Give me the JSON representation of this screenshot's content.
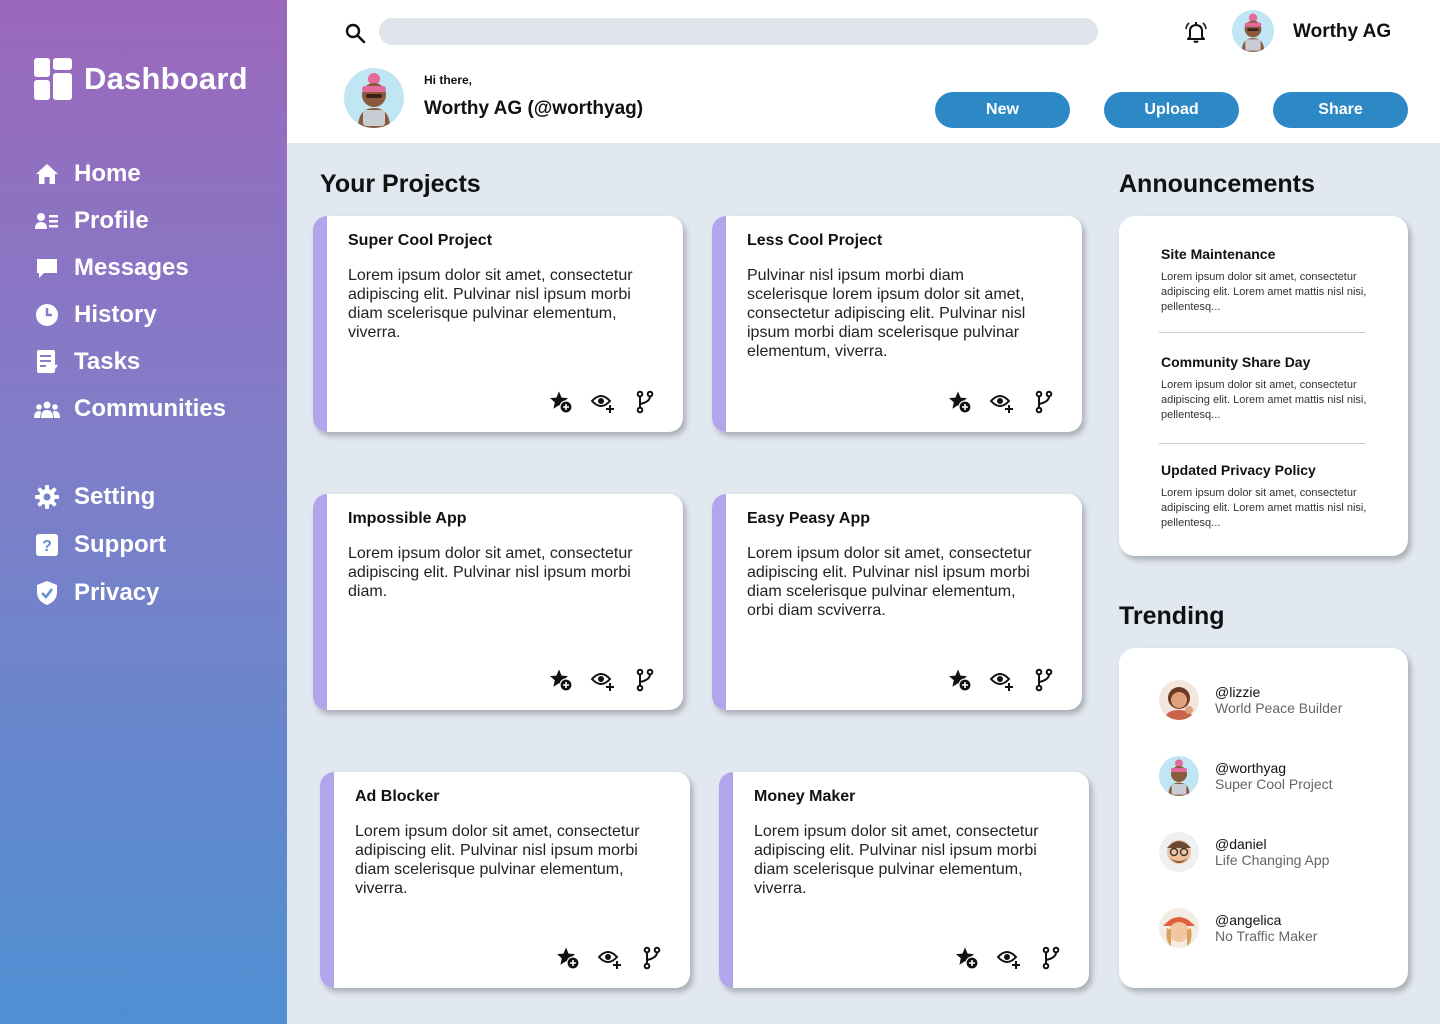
{
  "brand": {
    "title": "Dashboard"
  },
  "nav": {
    "main": [
      {
        "label": "Home",
        "icon": "home-icon"
      },
      {
        "label": "Profile",
        "icon": "profile-icon"
      },
      {
        "label": "Messages",
        "icon": "messages-icon"
      },
      {
        "label": "History",
        "icon": "history-icon"
      },
      {
        "label": "Tasks",
        "icon": "tasks-icon"
      },
      {
        "label": "Communities",
        "icon": "communities-icon"
      }
    ],
    "secondary": [
      {
        "label": "Setting",
        "icon": "gear-icon"
      },
      {
        "label": "Support",
        "icon": "support-icon"
      },
      {
        "label": "Privacy",
        "icon": "shield-icon"
      }
    ]
  },
  "header": {
    "search_value": "",
    "user_name": "Worthy AG",
    "greeting": "Hi there,",
    "display_name": "Worthy AG (@worthyag)",
    "buttons": {
      "new": "New",
      "upload": "Upload",
      "share": "Share"
    }
  },
  "projects": {
    "title": "Your Projects",
    "items": [
      {
        "title": "Super Cool Project",
        "body": "Lorem ipsum dolor sit amet, consectetur adipiscing elit. Pulvinar nisl ipsum morbi diam scelerisque pulvinar elementum, viverra."
      },
      {
        "title": "Less Cool Project",
        "body": "Pulvinar nisl ipsum morbi diam scelerisque lorem ipsum dolor sit amet, consectetur adipiscing elit. Pulvinar nisl ipsum morbi diam scelerisque pulvinar elementum, viverra."
      },
      {
        "title": "Impossible App",
        "body": "Lorem ipsum dolor sit amet, consectetur adipiscing elit. Pulvinar nisl ipsum morbi diam."
      },
      {
        "title": "Easy Peasy App",
        "body": "Lorem ipsum dolor sit amet, consectetur adipiscing elit. Pulvinar nisl ipsum morbi diam scelerisque pulvinar elementum, orbi diam scviverra."
      },
      {
        "title": "Ad Blocker",
        "body": "Lorem ipsum dolor sit amet, consectetur adipiscing elit. Pulvinar nisl ipsum morbi diam scelerisque pulvinar elementum, viverra."
      },
      {
        "title": "Money Maker",
        "body": "Lorem ipsum dolor sit amet, consectetur adipiscing elit. Pulvinar nisl ipsum morbi diam scelerisque pulvinar elementum, viverra."
      }
    ]
  },
  "announcements": {
    "title": "Announcements",
    "items": [
      {
        "title": "Site Maintenance",
        "text": "Lorem ipsum dolor sit amet, consectetur adipiscing elit. Lorem amet mattis nisl nisi, pellentesq..."
      },
      {
        "title": "Community Share Day",
        "text": "Lorem ipsum dolor sit amet, consectetur adipiscing elit. Lorem amet mattis nisl nisi, pellentesq..."
      },
      {
        "title": "Updated Privacy Policy",
        "text": "Lorem ipsum dolor sit amet, consectetur adipiscing elit. Lorem amet mattis nisl nisi, pellentesq..."
      }
    ]
  },
  "trending": {
    "title": "Trending",
    "items": [
      {
        "handle": "@lizzie",
        "project": "World Peace Builder"
      },
      {
        "handle": "@worthyag",
        "project": "Super Cool Project"
      },
      {
        "handle": "@daniel",
        "project": "Life Changing App"
      },
      {
        "handle": "@angelica",
        "project": "No Traffic Maker"
      }
    ]
  },
  "colors": {
    "accent": "#2c89c6",
    "card_stripe": "#b3a5ec",
    "background": "#e2e8f0"
  }
}
